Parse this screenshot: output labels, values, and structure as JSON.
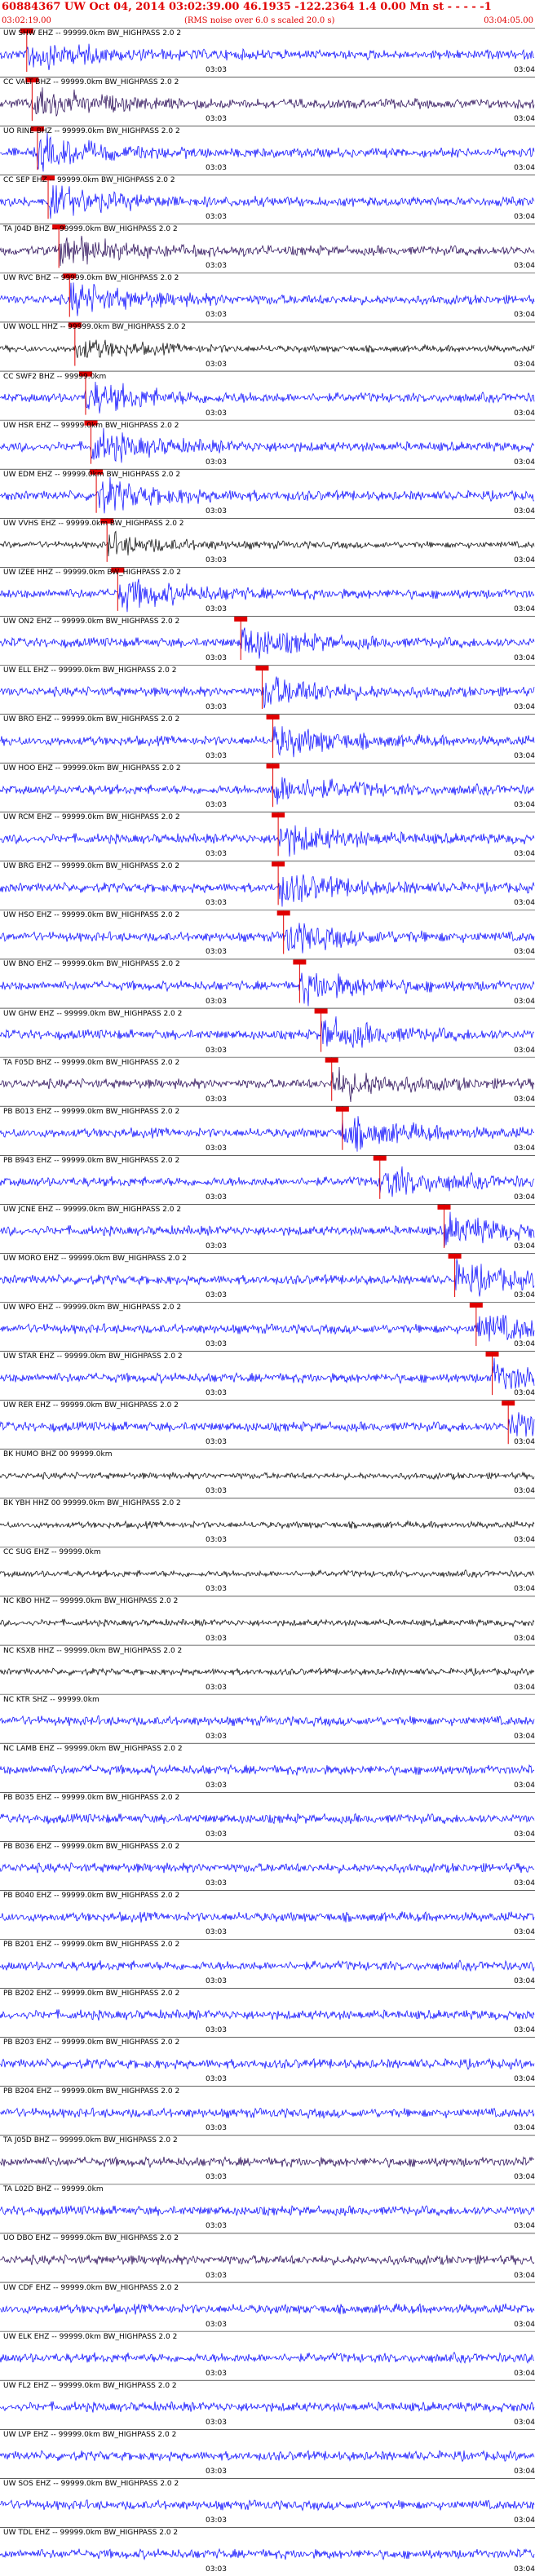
{
  "header": {
    "title": "60884367 UW Oct 04, 2014 03:02:39.00   46.1935 -122.2364  1.4 0.00 Mn st - - - -  -1",
    "subtitle": "(RMS noise over 6.0 s scaled 20.0 s)",
    "start_time": "03:02:19.00",
    "end_time": "03:04:05.00"
  },
  "tick_label": "03:03",
  "tick_label_edge": "03:04",
  "colors": {
    "pick": "#e00000",
    "blue": "#0000ff",
    "black": "#000000",
    "purple": "#200050",
    "label": "#000000"
  },
  "traces": [
    {
      "label": "UW SHW EHZ -- 99999.0km BW_HIGHPASS  2.0  2",
      "color": "blue",
      "pick": 0.05
    },
    {
      "label": "CC VALT BHZ -- 99999.0km BW_HIGHPASS  2.0  2",
      "color": "purple",
      "pick": 0.06
    },
    {
      "label": "UO RINE BHZ -- 99999.0km BW_HIGHPASS  2.0  2",
      "color": "blue",
      "pick": 0.07
    },
    {
      "label": "CC SEP EHZ -- 99999.0km BW_HIGHPASS  2.0  2",
      "color": "blue",
      "pick": 0.09
    },
    {
      "label": "TA J04D BHZ -- 99999.0km BW_HIGHPASS  2.0  2",
      "color": "purple",
      "pick": 0.11
    },
    {
      "label": "UW RVC BHZ -- 99999.0km BW_HIGHPASS  2.0  2",
      "color": "blue",
      "pick": 0.13
    },
    {
      "label": "UW WOLL HHZ -- 99999.0km BW_HIGHPASS  2.0  2",
      "color": "black",
      "pick": 0.14
    },
    {
      "label": "CC SWF2 BHZ -- 99999.0km",
      "color": "blue",
      "pick": 0.16
    },
    {
      "label": "UW HSR EHZ -- 99999.0km BW_HIGHPASS  2.0  2",
      "color": "blue",
      "pick": 0.17
    },
    {
      "label": "UW EDM EHZ -- 99999.0km BW_HIGHPASS  2.0  2",
      "color": "blue",
      "pick": 0.18
    },
    {
      "label": "UW VVHS EHZ -- 99999.0km BW_HIGHPASS  2.0  2",
      "color": "black",
      "pick": 0.2
    },
    {
      "label": "UW IZEE HHZ -- 99999.0km BW_HIGHPASS  2.0  2",
      "color": "blue",
      "pick": 0.22
    },
    {
      "label": "UW ON2 EHZ -- 99999.0km BW_HIGHPASS  2.0  2",
      "color": "blue",
      "pick": 0.45
    },
    {
      "label": "UW ELL EHZ -- 99999.0km BW_HIGHPASS  2.0  2",
      "color": "blue",
      "pick": 0.49
    },
    {
      "label": "UW BRO EHZ -- 99999.0km BW_HIGHPASS  2.0  2",
      "color": "blue",
      "pick": 0.51
    },
    {
      "label": "UW HOO EHZ -- 99999.0km BW_HIGHPASS  2.0  2",
      "color": "blue",
      "pick": 0.51
    },
    {
      "label": "UW RCM EHZ -- 99999.0km BW_HIGHPASS  2.0  2",
      "color": "blue",
      "pick": 0.52
    },
    {
      "label": "UW BRG EHZ -- 99999.0km BW_HIGHPASS  2.0  2",
      "color": "blue",
      "pick": 0.52
    },
    {
      "label": "UW HSO EHZ -- 99999.0km BW_HIGHPASS  2.0  2",
      "color": "blue",
      "pick": 0.53
    },
    {
      "label": "UW BNO EHZ -- 99999.0km BW_HIGHPASS  2.0  2",
      "color": "blue",
      "pick": 0.56
    },
    {
      "label": "UW GHW EHZ -- 99999.0km BW_HIGHPASS  2.0  2",
      "color": "blue",
      "pick": 0.6
    },
    {
      "label": "TA F05D BHZ -- 99999.0km BW_HIGHPASS  2.0  2",
      "color": "purple",
      "pick": 0.62
    },
    {
      "label": "PB B013 EHZ -- 99999.0km BW_HIGHPASS  2.0  2",
      "color": "blue",
      "pick": 0.64
    },
    {
      "label": "PB B943 EHZ -- 99999.0km BW_HIGHPASS  2.0  2",
      "color": "blue",
      "pick": 0.71
    },
    {
      "label": "UW JCNE EHZ -- 99999.0km BW_HIGHPASS  2.0  2",
      "color": "blue",
      "pick": 0.83
    },
    {
      "label": "UW MORO EHZ -- 99999.0km BW_HIGHPASS  2.0  2",
      "color": "blue",
      "pick": 0.85
    },
    {
      "label": "UW WPO EHZ -- 99999.0km BW_HIGHPASS  2.0  2",
      "color": "blue",
      "pick": 0.89
    },
    {
      "label": "UW STAR EHZ -- 99999.0km BW_HIGHPASS  2.0  2",
      "color": "blue",
      "pick": 0.92
    },
    {
      "label": "UW RER EHZ -- 99999.0km BW_HIGHPASS  2.0  2",
      "color": "blue",
      "pick": 0.95
    },
    {
      "label": "BK HUMO BHZ 00 99999.0km",
      "color": "black",
      "pick": null
    },
    {
      "label": "BK YBH HHZ 00 99999.0km BW_HIGHPASS  2.0  2",
      "color": "black",
      "pick": null
    },
    {
      "label": "CC SUG EHZ -- 99999.0km",
      "color": "black",
      "pick": null
    },
    {
      "label": "NC KBO HHZ -- 99999.0km BW_HIGHPASS  2.0  2",
      "color": "black",
      "pick": null
    },
    {
      "label": "NC KSXB HHZ -- 99999.0km BW_HIGHPASS  2.0  2",
      "color": "black",
      "pick": null
    },
    {
      "label": "NC KTR SHZ -- 99999.0km",
      "color": "blue",
      "pick": null
    },
    {
      "label": "NC LAMB EHZ -- 99999.0km BW_HIGHPASS  2.0  2",
      "color": "blue",
      "pick": null
    },
    {
      "label": "PB B035 EHZ -- 99999.0km BW_HIGHPASS  2.0  2",
      "color": "blue",
      "pick": null
    },
    {
      "label": "PB B036 EHZ -- 99999.0km BW_HIGHPASS  2.0  2",
      "color": "blue",
      "pick": null
    },
    {
      "label": "PB B040 EHZ -- 99999.0km BW_HIGHPASS  2.0  2",
      "color": "blue",
      "pick": null
    },
    {
      "label": "PB B201 EHZ -- 99999.0km BW_HIGHPASS  2.0  2",
      "color": "blue",
      "pick": null
    },
    {
      "label": "PB B202 EHZ -- 99999.0km BW_HIGHPASS  2.0  2",
      "color": "blue",
      "pick": null
    },
    {
      "label": "PB B203 EHZ -- 99999.0km BW_HIGHPASS  2.0  2",
      "color": "blue",
      "pick": null
    },
    {
      "label": "PB B204 EHZ -- 99999.0km BW_HIGHPASS  2.0  2",
      "color": "blue",
      "pick": null
    },
    {
      "label": "TA J05D BHZ -- 99999.0km BW_HIGHPASS  2.0  2",
      "color": "purple",
      "pick": null
    },
    {
      "label": "TA L02D BHZ -- 99999.0km",
      "color": "blue",
      "pick": null
    },
    {
      "label": "UO DBO EHZ -- 99999.0km BW_HIGHPASS  2.0  2",
      "color": "purple",
      "pick": null
    },
    {
      "label": "UW CDF EHZ -- 99999.0km BW_HIGHPASS  2.0  2",
      "color": "blue",
      "pick": null
    },
    {
      "label": "UW ELK EHZ -- 99999.0km BW_HIGHPASS  2.0  2",
      "color": "blue",
      "pick": null
    },
    {
      "label": "UW FL2 EHZ -- 99999.0km BW_HIGHPASS  2.0  2",
      "color": "blue",
      "pick": null
    },
    {
      "label": "UW LVP EHZ -- 99999.0km BW_HIGHPASS  2.0  2",
      "color": "blue",
      "pick": null
    },
    {
      "label": "UW SOS EHZ -- 99999.0km BW_HIGHPASS  2.0  2",
      "color": "blue",
      "pick": null
    },
    {
      "label": "UW TDL EHZ -- 99999.0km BW_HIGHPASS  2.0  2",
      "color": "blue",
      "pick": null
    }
  ]
}
